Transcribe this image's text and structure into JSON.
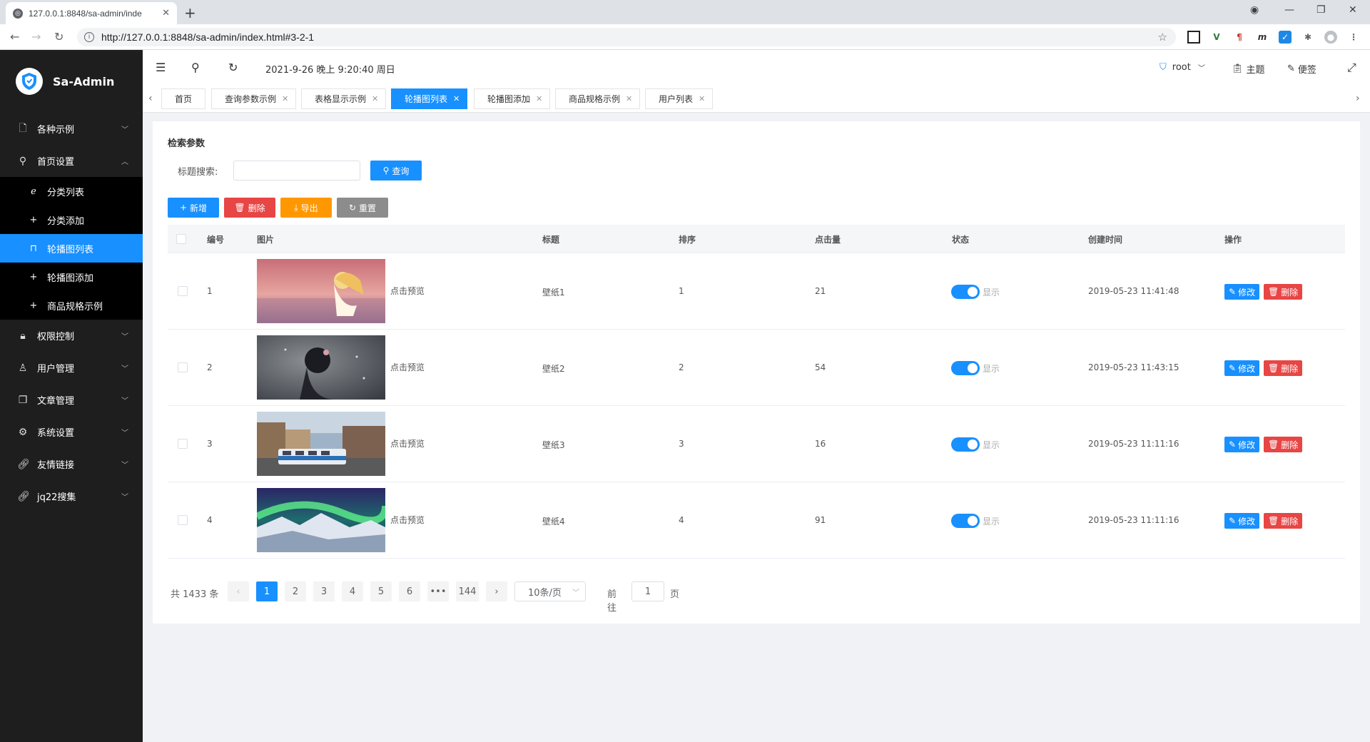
{
  "browser": {
    "tab_title": "127.0.0.1:8848/sa-admin/inde",
    "url": "http://127.0.0.1:8848/sa-admin/index.html#3-2-1"
  },
  "sidebar": {
    "logo_text": "Sa-Admin",
    "menus": [
      {
        "label": "各种示例",
        "icon": "file-icon"
      },
      {
        "label": "首页设置",
        "icon": "search-icon",
        "expanded": true,
        "items": [
          {
            "label": "分类列表",
            "icon": "edge-icon"
          },
          {
            "label": "分类添加",
            "icon": "plus-icon"
          },
          {
            "label": "轮播图列表",
            "icon": "bookmark-icon",
            "active": true
          },
          {
            "label": "轮播图添加",
            "icon": "plus-icon"
          },
          {
            "label": "商品规格示例",
            "icon": "plus-icon"
          }
        ]
      },
      {
        "label": "权限控制",
        "icon": "lock-icon"
      },
      {
        "label": "用户管理",
        "icon": "user-icon"
      },
      {
        "label": "文章管理",
        "icon": "copy-icon"
      },
      {
        "label": "系统设置",
        "icon": "gear-icon"
      },
      {
        "label": "友情链接",
        "icon": "link-icon"
      },
      {
        "label": "jq22搜集",
        "icon": "link-icon"
      }
    ]
  },
  "header": {
    "datetime": "2021-9-26 晚上 9:20:40 周日",
    "user": "root",
    "theme_label": "主题",
    "note_label": "便签"
  },
  "tabs": [
    {
      "label": "首页"
    },
    {
      "label": "查询参数示例"
    },
    {
      "label": "表格显示示例"
    },
    {
      "label": "轮播图列表",
      "active": true
    },
    {
      "label": "轮播图添加"
    },
    {
      "label": "商品规格示例"
    },
    {
      "label": "用户列表"
    }
  ],
  "search": {
    "section_title": "检索参数",
    "label": "标题搜索:",
    "query_button": "查询",
    "value": ""
  },
  "actions": {
    "add": "新增",
    "delete": "删除",
    "export": "导出",
    "reset": "重置"
  },
  "table": {
    "columns": [
      "编号",
      "图片",
      "标题",
      "排序",
      "点击量",
      "状态",
      "创建时间",
      "操作"
    ],
    "preview_text": "点击预览",
    "edit_label": "修改",
    "delete_label": "删除",
    "rows": [
      {
        "id": "1",
        "title": "壁纸1",
        "sort": "1",
        "clicks": "21",
        "status": "显示",
        "created": "2019-05-23 11:41:48",
        "image": "anime-girl-sunset"
      },
      {
        "id": "2",
        "title": "壁纸2",
        "sort": "2",
        "clicks": "54",
        "status": "显示",
        "created": "2019-05-23 11:43:15",
        "image": "anime-girl-dark"
      },
      {
        "id": "3",
        "title": "壁纸3",
        "sort": "3",
        "clicks": "16",
        "status": "显示",
        "created": "2019-05-23 11:11:16",
        "image": "tram-city-street"
      },
      {
        "id": "4",
        "title": "壁纸4",
        "sort": "4",
        "clicks": "91",
        "status": "显示",
        "created": "2019-05-23 11:11:16",
        "image": "aurora-mountains"
      }
    ]
  },
  "pagination": {
    "total_text": "共 1433 条",
    "pages": [
      "1",
      "2",
      "3",
      "4",
      "5",
      "6",
      "•••",
      "144"
    ],
    "current": "1",
    "page_size": "10条/页",
    "goto_label": "前往",
    "goto_value": "1",
    "page_suffix": "页"
  },
  "colors": {
    "accent": "#1890ff",
    "danger": "#e84545",
    "warning": "#ff9800",
    "sidebar_bg": "#1e1e1e"
  }
}
